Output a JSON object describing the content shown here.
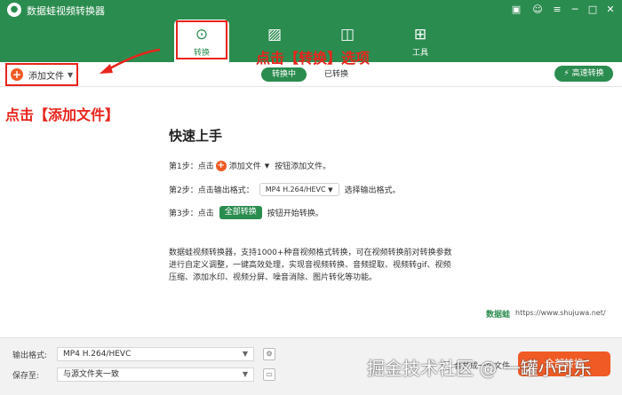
{
  "window": {
    "title": "数据蛙视频转换器",
    "controls": [
      "gift-icon",
      "menu-icon",
      "minimize-icon",
      "maximize-icon",
      "close-icon"
    ]
  },
  "tabs": [
    {
      "label": "转换",
      "icon": "convert-icon",
      "active": true
    },
    {
      "label": "",
      "icon": "image-icon",
      "active": false
    },
    {
      "label": "",
      "icon": "layout-icon",
      "active": false
    },
    {
      "label": "工具",
      "icon": "toolbox-icon",
      "active": false
    }
  ],
  "toolbar": {
    "add_file_label": "添加文件",
    "segments": [
      "转换中",
      "已转换"
    ],
    "fast_convert_label": "高速转换"
  },
  "annotations": {
    "convert_tab_hint": "点击【转换】选项",
    "add_file_hint": "点击【添加文件】"
  },
  "guide": {
    "title": "快速上手",
    "step1_prefix": "第1步：点击",
    "step1_button": "添加文件",
    "step1_suffix": "按钮添加文件。",
    "step2_prefix": "第2步：点击输出格式：",
    "step2_format": "MP4 H.264/HEVC",
    "step2_suffix": "选择输出格式。",
    "step3_prefix": "第3步：点击",
    "step3_button": "全部转换",
    "step3_suffix": "按钮开始转换。",
    "description": "数据蛙视频转换器，支持1000+种音视频格式转换，可在视频转换前对转换参数进行自定义调整，一键高效处理，实现音视频转换、音频提取、视频转gif、视频压缩、添加水印、视频分屏、噪音消除、图片转化等功能。",
    "brand": "数据蛙",
    "url": "https://www.shujuwa.net/"
  },
  "bottom": {
    "output_format_label": "输出格式:",
    "output_format_value": "MP4 H.264/HEVC",
    "save_to_label": "保存至:",
    "save_to_value": "与源文件夹一致",
    "merge_label": "合并成一个文件",
    "convert_all_label": "全部转换"
  },
  "watermark": "掘金技术社区 @ 一罐小可乐",
  "colors": {
    "brand_green": "#2b8c4f",
    "accent_orange": "#f05a24",
    "annotation_red": "#e8241c"
  }
}
